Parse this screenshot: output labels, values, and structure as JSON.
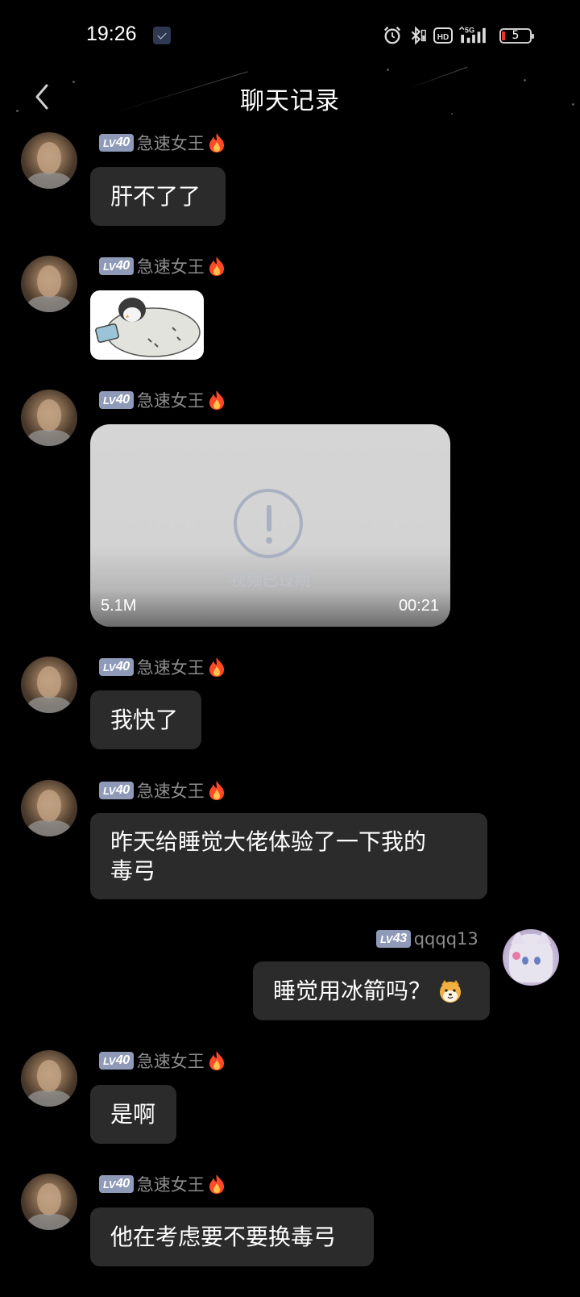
{
  "status_bar": {
    "time": "19:26",
    "battery": "5",
    "hd_label": "HD",
    "network_label": "5G",
    "icons": [
      "notification-icon",
      "alarm-icon",
      "bluetooth-icon",
      "hd-icon",
      "signal-icon",
      "battery-icon"
    ]
  },
  "header": {
    "title": "聊天记录",
    "back_icon": "chevron-left-icon"
  },
  "messages": [
    {
      "side": "left",
      "level_prefix": "LV",
      "level": "40",
      "sender": "急速女王",
      "type": "text",
      "text": "肝不了了"
    },
    {
      "side": "left",
      "level_prefix": "LV",
      "level": "40",
      "sender": "急速女王",
      "type": "sticker",
      "sticker": "penguin-sticker"
    },
    {
      "side": "left",
      "level_prefix": "LV",
      "level": "40",
      "sender": "急速女王",
      "type": "video",
      "status": "视频已过期",
      "size": "5.1M",
      "duration": "00:21"
    },
    {
      "side": "left",
      "level_prefix": "LV",
      "level": "40",
      "sender": "急速女王",
      "type": "text",
      "text": "我快了"
    },
    {
      "side": "left",
      "level_prefix": "LV",
      "level": "40",
      "sender": "急速女王",
      "type": "text",
      "line1": "昨天给睡觉大佬体验了一下我的",
      "line2": "毒弓"
    },
    {
      "side": "right",
      "level_prefix": "LV",
      "level": "43",
      "sender": "qqqq13",
      "type": "text",
      "text": "睡觉用冰箭吗？",
      "emoji": "shiba-dog-emoji"
    },
    {
      "side": "left",
      "level_prefix": "LV",
      "level": "40",
      "sender": "急速女王",
      "type": "text",
      "text": "是啊"
    },
    {
      "side": "left",
      "level_prefix": "LV",
      "level": "40",
      "sender": "急速女王",
      "type": "text",
      "text": "他在考虑要不要换毒弓"
    }
  ],
  "colors": {
    "background": "#000000",
    "bubble": "#2b2b2b",
    "level_badge": "#8f9ab8",
    "sender_name": "#8d8d8d"
  }
}
